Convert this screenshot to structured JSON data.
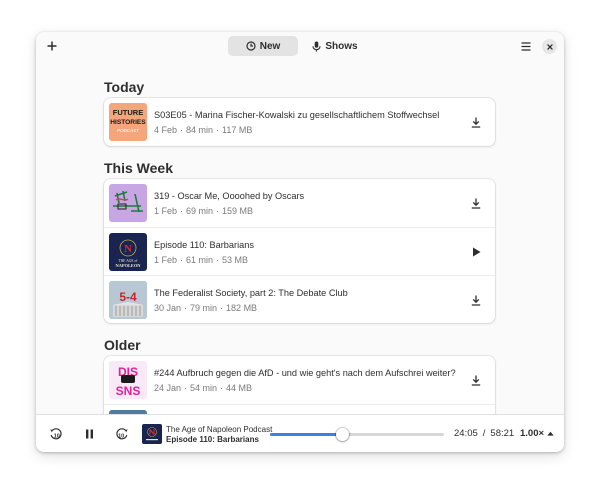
{
  "header": {
    "add_icon": "plus-icon",
    "tabs": [
      {
        "label": "New",
        "icon": "clock-icon",
        "active": true
      },
      {
        "label": "Shows",
        "icon": "microphone-icon",
        "active": false
      }
    ],
    "menu_icon": "hamburger-menu-icon",
    "close_icon": "close-icon"
  },
  "sections": [
    {
      "title": "Today",
      "episodes": [
        {
          "title": "S03E05 - Marina Fischer-Kowalski zu gesellschaftlichem Stoffwechsel",
          "date": "4 Feb",
          "duration": "84 min",
          "size": "117 MB",
          "action": "download-icon",
          "art": {
            "line1": "FUTURE",
            "line2": "HISTORIES",
            "line3": "PODCAST",
            "bg": "#f4a57c"
          }
        }
      ]
    },
    {
      "title": "This Week",
      "episodes": [
        {
          "title": "319 - Oscar Me, Oooohed by Oscars",
          "date": "1 Feb",
          "duration": "69 min",
          "size": "159 MB",
          "action": "download-icon",
          "art": {
            "bg": "#c7a6e3"
          }
        },
        {
          "title": "Episode 110: Barbarians",
          "date": "1 Feb",
          "duration": "61 min",
          "size": "53 MB",
          "action": "play-icon",
          "art": {
            "letter": "N",
            "caption1": "THE AGE of",
            "caption2": "NAPOLEON",
            "bg": "#1a2450"
          }
        },
        {
          "title": "The Federalist Society, part 2: The Debate Club",
          "date": "30 Jan",
          "duration": "79 min",
          "size": "182 MB",
          "action": "download-icon",
          "art": {
            "text": "5-4",
            "bg": "#a9b8c4"
          }
        }
      ]
    },
    {
      "title": "Older",
      "episodes": [
        {
          "title": "#244 Aufbruch gegen die AfD - und wie geht's nach dem Aufschrei weiter?",
          "date": "24 Jan",
          "duration": "54 min",
          "size": "44 MB",
          "action": "download-icon",
          "art": {
            "line1": "DIS",
            "line2": "SNS",
            "bg": "#f7e9f5"
          }
        }
      ]
    }
  ],
  "player": {
    "rewind_label": "10",
    "forward_label": "10",
    "pause_icon": "pause-icon",
    "show": "The Age of Napoleon Podcast",
    "episode": "Episode 110: Barbarians",
    "elapsed": "24:05",
    "separator": "/",
    "total": "58:21",
    "progress": 0.413,
    "speed": "1.00×"
  },
  "colors": {
    "accent": "#3584e4",
    "window_bg": "#fafafa",
    "card_bg": "#ffffff"
  }
}
